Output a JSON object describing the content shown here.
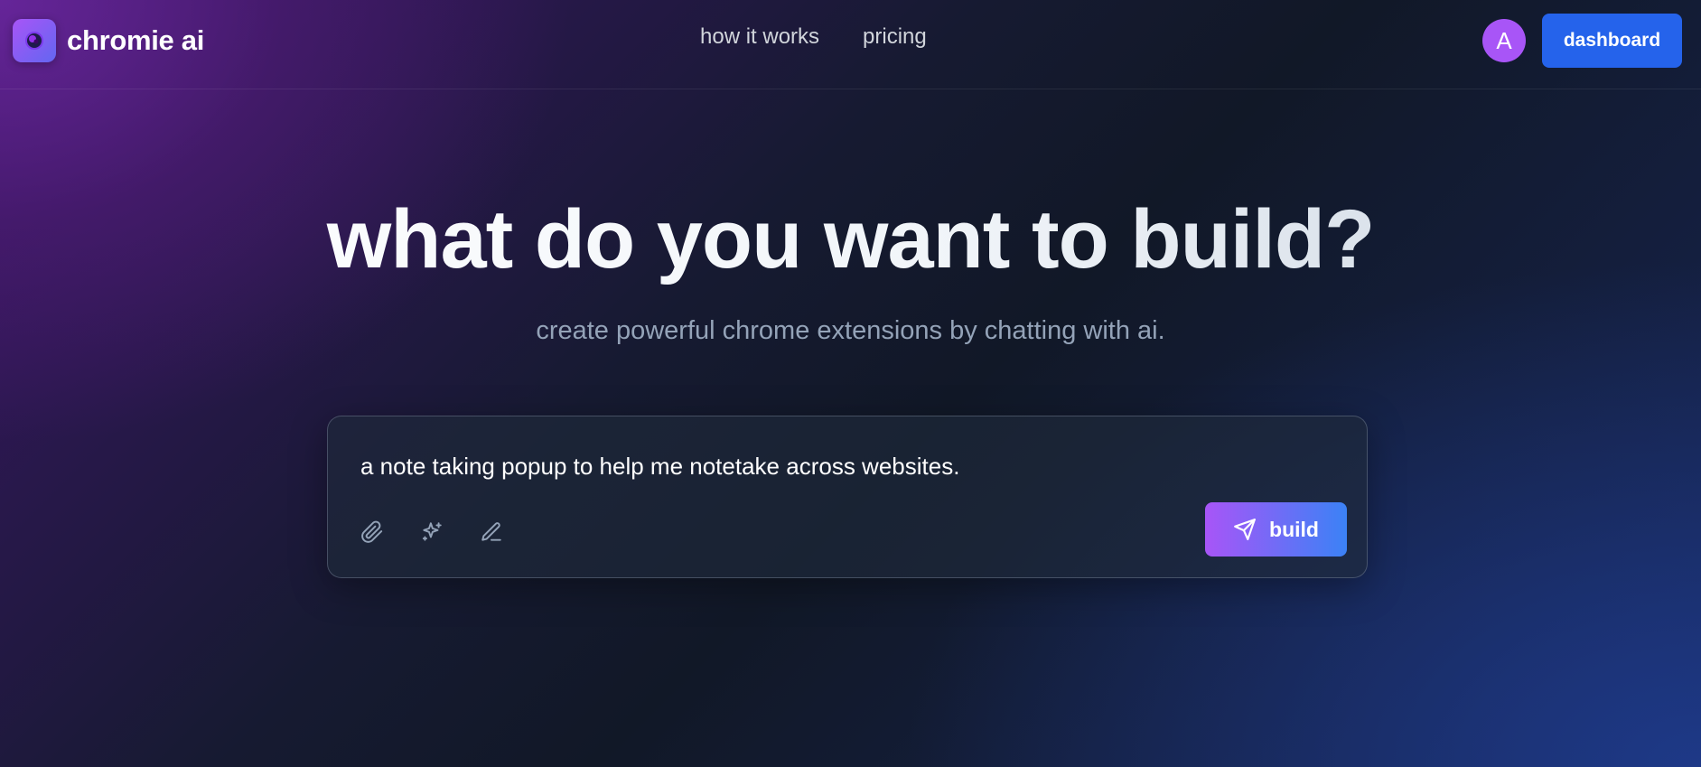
{
  "header": {
    "brand_name": "chromie ai",
    "logo_icon": "chromie-logo-icon",
    "nav": [
      {
        "label": "how it works"
      },
      {
        "label": "pricing"
      }
    ],
    "avatar_initial": "A",
    "dashboard_label": "dashboard"
  },
  "hero": {
    "title": "what do you want to build?",
    "subtitle": "create powerful chrome extensions by chatting with ai."
  },
  "prompt": {
    "value": "a note taking popup to help me notetake across websites.",
    "tools": [
      "paperclip-icon",
      "sparkles-icon",
      "pencil-icon"
    ],
    "build_label": "build",
    "build_icon": "send-icon"
  },
  "colors": {
    "accent_purple": "#a855f7",
    "accent_blue": "#3b82f6",
    "dashboard_blue": "#2563eb",
    "background_dark": "#111827"
  }
}
